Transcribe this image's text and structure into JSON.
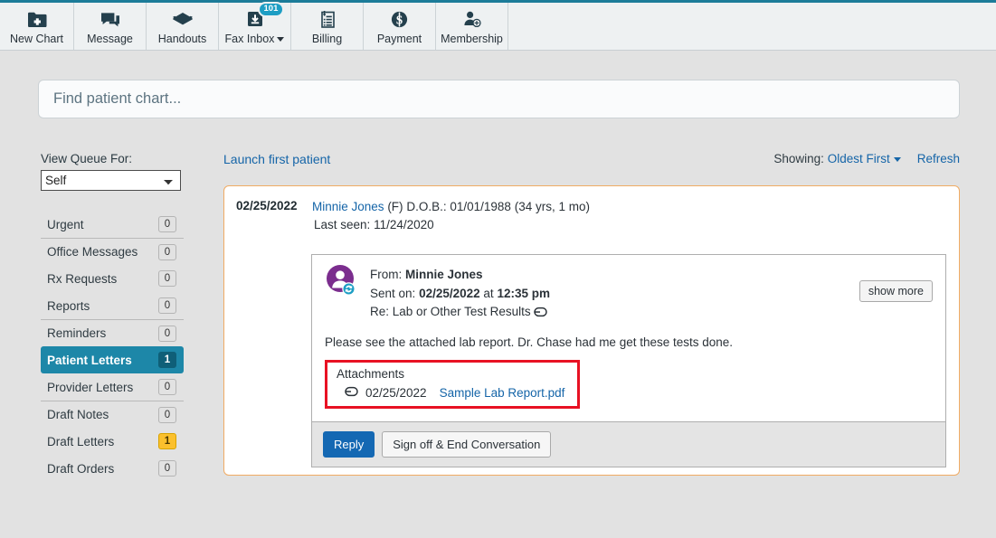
{
  "theme": {
    "accent": "#1d87a8",
    "link": "#1565a8",
    "card_border": "#f0ab63",
    "highlight_box": "#e81123",
    "primary_button": "#1468b3",
    "badge_blue": "#1d9ec4",
    "badge_yellow": "#fbc02d",
    "avatar_purple": "#7b2d8e",
    "page_background": "#e2e2e2"
  },
  "toolbar": {
    "items": [
      {
        "label": "New Chart",
        "icon": "new-chart-icon",
        "badge": null,
        "caret": false
      },
      {
        "label": "Message",
        "icon": "message-icon",
        "badge": null,
        "caret": false
      },
      {
        "label": "Handouts",
        "icon": "handouts-icon",
        "badge": null,
        "caret": false
      },
      {
        "label": "Fax Inbox",
        "icon": "fax-inbox-icon",
        "badge": "101",
        "caret": true
      },
      {
        "label": "Billing",
        "icon": "billing-icon",
        "badge": null,
        "caret": false
      },
      {
        "label": "Payment",
        "icon": "payment-icon",
        "badge": null,
        "caret": false
      },
      {
        "label": "Membership",
        "icon": "membership-icon",
        "badge": null,
        "caret": false
      }
    ]
  },
  "search": {
    "placeholder": "Find patient chart...",
    "value": ""
  },
  "sidebar": {
    "queue_label": "View Queue For:",
    "queue_selected": "Self",
    "queue_options": [
      "Self"
    ],
    "items": [
      {
        "label": "Urgent",
        "count": "0",
        "active": false,
        "separator": false,
        "warn": false
      },
      {
        "label": "Office Messages",
        "count": "0",
        "active": false,
        "separator": true,
        "warn": false
      },
      {
        "label": "Rx Requests",
        "count": "0",
        "active": false,
        "separator": false,
        "warn": false
      },
      {
        "label": "Reports",
        "count": "0",
        "active": false,
        "separator": false,
        "warn": false
      },
      {
        "label": "Reminders",
        "count": "0",
        "active": false,
        "separator": true,
        "warn": false
      },
      {
        "label": "Patient Letters",
        "count": "1",
        "active": true,
        "separator": false,
        "warn": false
      },
      {
        "label": "Provider Letters",
        "count": "0",
        "active": false,
        "separator": false,
        "warn": false
      },
      {
        "label": "Draft Notes",
        "count": "0",
        "active": false,
        "separator": true,
        "warn": false
      },
      {
        "label": "Draft Letters",
        "count": "1",
        "active": false,
        "separator": false,
        "warn": true
      },
      {
        "label": "Draft Orders",
        "count": "0",
        "active": false,
        "separator": false,
        "warn": false
      }
    ]
  },
  "main": {
    "launch_link": "Launch first patient",
    "showing_label": "Showing:",
    "showing_value": "Oldest First",
    "refresh_label": "Refresh"
  },
  "patient": {
    "date": "02/25/2022",
    "name": "Minnie Jones",
    "sex": "(F)",
    "dob_label": "D.O.B.:",
    "dob": "01/01/1988",
    "age": "(34 yrs, 1 mo)",
    "last_seen_label": "Last seen:",
    "last_seen": "11/24/2020"
  },
  "message": {
    "from_label": "From:",
    "from_value": "Minnie Jones",
    "sent_label": "Sent on:",
    "sent_date": "02/25/2022",
    "sent_at_word": "at",
    "sent_time": "12:35 pm",
    "re_label": "Re:",
    "re_value": "Lab or Other Test Results",
    "show_more_label": "show more",
    "body": "Please see the attached lab report. Dr. Chase had me get these tests done.",
    "attachments_title": "Attachments",
    "attachments": [
      {
        "date": "02/25/2022",
        "filename": "Sample Lab Report.pdf"
      }
    ],
    "reply_button": "Reply",
    "signoff_button": "Sign off & End Conversation"
  }
}
